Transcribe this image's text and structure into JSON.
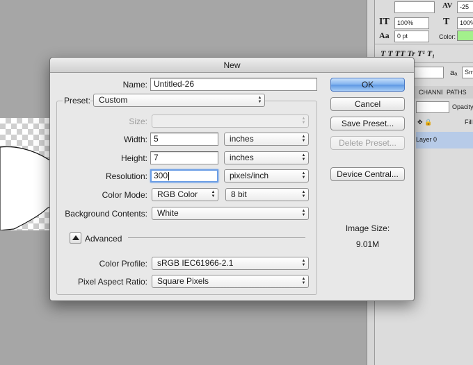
{
  "dialog": {
    "title": "New",
    "name_label": "Name:",
    "name_value": "Untitled-26",
    "preset_label": "Preset:",
    "preset_value": "Custom",
    "size_label": "Size:",
    "size_value": "",
    "width_label": "Width:",
    "width_value": "5",
    "width_unit": "inches",
    "height_label": "Height:",
    "height_value": "7",
    "height_unit": "inches",
    "resolution_label": "Resolution:",
    "resolution_value": "300",
    "resolution_unit": "pixels/inch",
    "color_mode_label": "Color Mode:",
    "color_mode_value": "RGB Color",
    "bit_depth_value": "8 bit",
    "background_label": "Background Contents:",
    "background_value": "White",
    "advanced_label": "Advanced",
    "color_profile_label": "Color Profile:",
    "color_profile_value": "sRGB IEC61966-2.1",
    "pixel_aspect_label": "Pixel Aspect Ratio:",
    "pixel_aspect_value": "Square Pixels",
    "buttons": {
      "ok": "OK",
      "cancel": "Cancel",
      "save_preset": "Save Preset...",
      "delete_preset": "Delete Preset...",
      "device_central": "Device Central..."
    },
    "image_size_label": "Image Size:",
    "image_size_value": "9.01M"
  },
  "right_panel": {
    "tracking_value": "-25",
    "vertical_scale_value": "100%",
    "horizontal_scale_value": "100%",
    "baseline_shift_value": "0 pt",
    "color_label": "Color:",
    "color_swatch": "#a3f08c",
    "style_buttons": "T  T  TT  Tr  T¹  T₁",
    "aa_label": "aₐ",
    "aa_value": "Smo",
    "tab_channels": "CHANNELS",
    "tab_paths": "PATHS",
    "opacity_label": "Opacity",
    "fill_label": "Fill",
    "layer_name": "Layer 0",
    "accent_color": "#b7cbe8"
  }
}
